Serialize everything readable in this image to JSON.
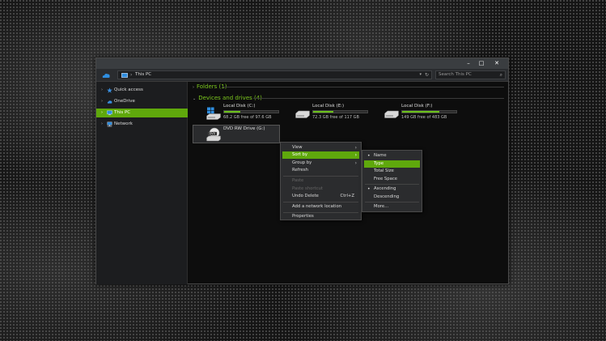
{
  "window": {
    "controls": {
      "minimize": "–",
      "maximize": "□",
      "close": "✕"
    }
  },
  "address": {
    "path": "This PC",
    "dropdown": "▾",
    "refresh": "↻",
    "search_placeholder": "Search This PC",
    "search_icon": "⌕"
  },
  "sidebar": {
    "items": [
      {
        "label": "Quick access",
        "icon": "star-icon",
        "active": false
      },
      {
        "label": "OneDrive",
        "icon": "cloud-icon",
        "active": false
      },
      {
        "label": "This PC",
        "icon": "computer-icon",
        "active": true
      },
      {
        "label": "Network",
        "icon": "network-icon",
        "active": false
      }
    ]
  },
  "content": {
    "folders_header": "Folders (1)",
    "drives_header": "Devices and drives (4)",
    "drives": [
      {
        "name": "Local Disk (C:)",
        "free": "68.2 GB free of 97.6 GB",
        "used_fraction": 0.3
      },
      {
        "name": "Local Disk (E:)",
        "free": "72.3 GB free of 117 GB",
        "used_fraction": 0.38
      },
      {
        "name": "Local Disk (F:)",
        "free": "149 GB free of 483 GB",
        "used_fraction": 0.69
      },
      {
        "name": "DVD RW Drive (G:)"
      }
    ]
  },
  "context_menu": {
    "items": {
      "view": "View",
      "sort_by": "Sort by",
      "group_by": "Group by",
      "refresh": "Refresh",
      "paste": "Paste",
      "paste_shortcut": "Paste shortcut",
      "undo_delete": "Undo Delete",
      "undo_delete_key": "Ctrl+Z",
      "add_network_location": "Add a network location",
      "properties": "Properties"
    }
  },
  "sort_submenu": {
    "items": {
      "name": "Name",
      "type": "Type",
      "total_size": "Total Size",
      "free_space": "Free Space",
      "ascending": "Ascending",
      "descending": "Descending",
      "more": "More..."
    }
  }
}
